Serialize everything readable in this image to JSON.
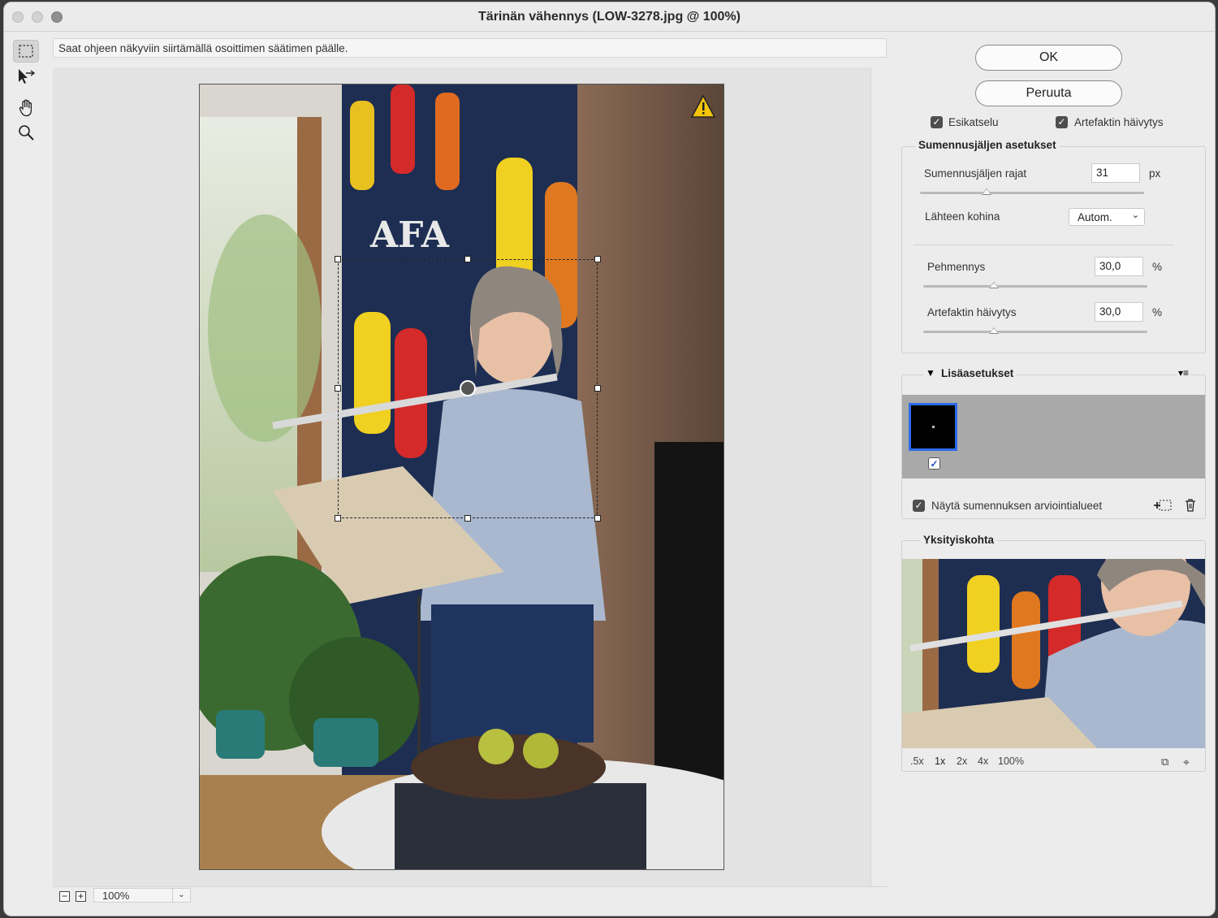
{
  "window": {
    "title": "Tärinän vähennys (LOW-3278.jpg @ 100%)"
  },
  "tools": [
    "marquee-tool",
    "direct-select-tool",
    "hand-tool",
    "zoom-tool"
  ],
  "hint": "Saat ohjeen näkyviin siirtämällä osoittimen säätimen päälle.",
  "zoom": {
    "value": "100%",
    "minus": "−",
    "plus": "+"
  },
  "buttons": {
    "ok": "OK",
    "cancel": "Peruuta"
  },
  "checks": {
    "preview": "Esikatselu",
    "artifact": "Artefaktin häivytys"
  },
  "trace": {
    "header": "Sumennusjäljen asetukset",
    "bounds_label": "Sumennusjäljen rajat",
    "bounds_value": "31",
    "bounds_unit": "px",
    "bounds_level": 0.29,
    "noise_label": "Lähteen kohina",
    "noise_value": "Autom.",
    "smooth_label": "Pehmennys",
    "smooth_value": "30,0",
    "smooth_unit": "%",
    "smooth_level": 0.3,
    "artifact_label": "Artefaktin häivytys",
    "artifact_value": "30,0",
    "artifact_unit": "%",
    "artifact_level": 0.3
  },
  "advanced": {
    "header": "Lisäasetukset",
    "show_regions": "Näytä sumennuksen arviointialueet"
  },
  "detail": {
    "header": "Yksityiskohta",
    "zooms": [
      ".5x",
      "1x",
      "2x",
      "4x",
      "100%"
    ]
  },
  "warning_icon": "warning-triangle-icon"
}
